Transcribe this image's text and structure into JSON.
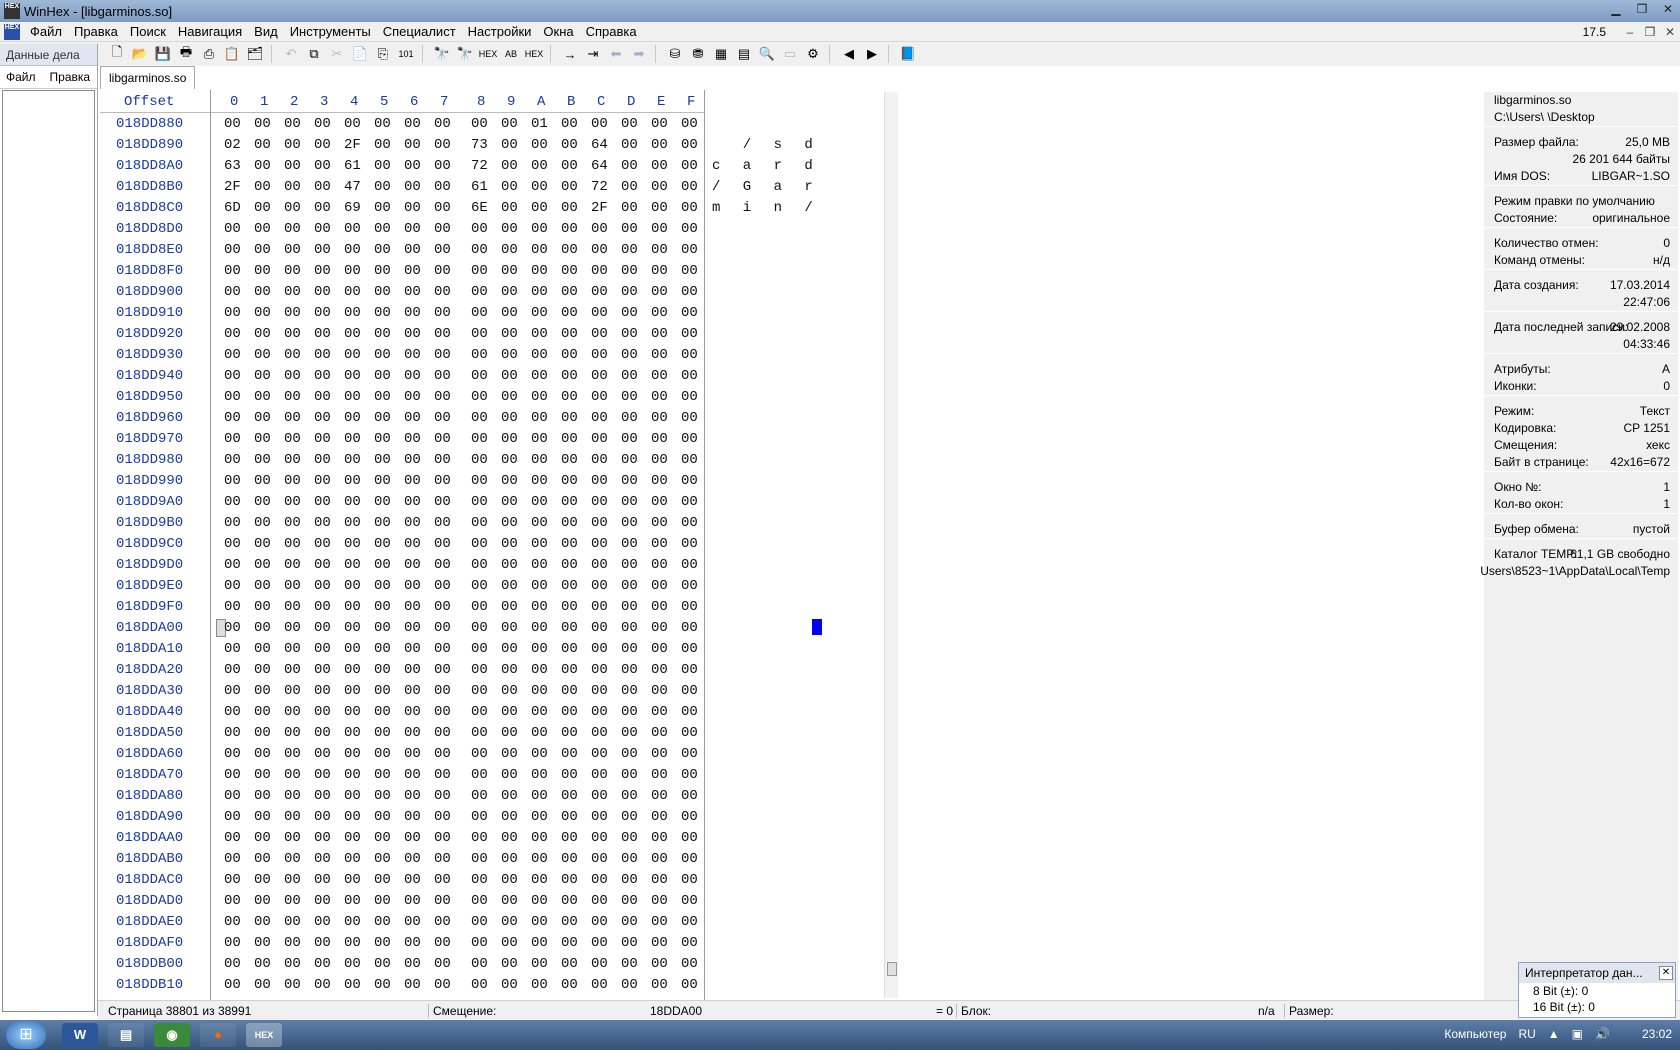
{
  "window": {
    "title": "WinHex - [libgarminos.so]",
    "app_icon": "HEX"
  },
  "menu": [
    "Файл",
    "Правка",
    "Поиск",
    "Навигация",
    "Вид",
    "Инструменты",
    "Специалист",
    "Настройки",
    "Окна",
    "Справка"
  ],
  "zoom": "17.5",
  "left_panel": {
    "title": "Данные дела",
    "menu_file": "Файл",
    "menu_edit": "Правка"
  },
  "tab": "libgarminos.so",
  "hex": {
    "header_offset": "Offset",
    "header_cols": [
      "0",
      "1",
      "2",
      "3",
      "4",
      "5",
      "6",
      "7",
      "8",
      "9",
      "A",
      "B",
      "C",
      "D",
      "E",
      "F"
    ],
    "rows": [
      {
        "off": "018DD880",
        "bytes": [
          "00",
          "00",
          "00",
          "00",
          "00",
          "00",
          "00",
          "00",
          "00",
          "00",
          "01",
          "00",
          "00",
          "00",
          "00",
          "00"
        ],
        "text": [
          "",
          "",
          "",
          "",
          "",
          "",
          "",
          "",
          "",
          "",
          "",
          "",
          "",
          "",
          "",
          ""
        ]
      },
      {
        "off": "018DD890",
        "bytes": [
          "02",
          "00",
          "00",
          "00",
          "2F",
          "00",
          "00",
          "00",
          "73",
          "00",
          "00",
          "00",
          "64",
          "00",
          "00",
          "00"
        ],
        "text": [
          "",
          "",
          "",
          "",
          "/",
          "",
          "",
          "",
          "s",
          "",
          "",
          "",
          "d",
          "",
          "",
          ""
        ]
      },
      {
        "off": "018DD8A0",
        "bytes": [
          "63",
          "00",
          "00",
          "00",
          "61",
          "00",
          "00",
          "00",
          "72",
          "00",
          "00",
          "00",
          "64",
          "00",
          "00",
          "00"
        ],
        "text": [
          "c",
          "",
          "",
          "",
          "a",
          "",
          "",
          "",
          "r",
          "",
          "",
          "",
          "d",
          "",
          "",
          ""
        ]
      },
      {
        "off": "018DD8B0",
        "bytes": [
          "2F",
          "00",
          "00",
          "00",
          "47",
          "00",
          "00",
          "00",
          "61",
          "00",
          "00",
          "00",
          "72",
          "00",
          "00",
          "00"
        ],
        "text": [
          "/",
          "",
          "",
          "",
          "G",
          "",
          "",
          "",
          "a",
          "",
          "",
          "",
          "r",
          "",
          "",
          ""
        ]
      },
      {
        "off": "018DD8C0",
        "bytes": [
          "6D",
          "00",
          "00",
          "00",
          "69",
          "00",
          "00",
          "00",
          "6E",
          "00",
          "00",
          "00",
          "2F",
          "00",
          "00",
          "00"
        ],
        "text": [
          "m",
          "",
          "",
          "",
          "i",
          "",
          "",
          "",
          "n",
          "",
          "",
          "",
          "/",
          "",
          "",
          ""
        ]
      },
      {
        "off": "018DD8D0"
      },
      {
        "off": "018DD8E0"
      },
      {
        "off": "018DD8F0"
      },
      {
        "off": "018DD900"
      },
      {
        "off": "018DD910"
      },
      {
        "off": "018DD920"
      },
      {
        "off": "018DD930"
      },
      {
        "off": "018DD940"
      },
      {
        "off": "018DD950"
      },
      {
        "off": "018DD960"
      },
      {
        "off": "018DD970"
      },
      {
        "off": "018DD980"
      },
      {
        "off": "018DD990"
      },
      {
        "off": "018DD9A0"
      },
      {
        "off": "018DD9B0"
      },
      {
        "off": "018DD9C0"
      },
      {
        "off": "018DD9D0"
      },
      {
        "off": "018DD9E0"
      },
      {
        "off": "018DD9F0"
      },
      {
        "off": "018DDA00"
      },
      {
        "off": "018DDA10"
      },
      {
        "off": "018DDA20"
      },
      {
        "off": "018DDA30"
      },
      {
        "off": "018DDA40"
      },
      {
        "off": "018DDA50"
      },
      {
        "off": "018DDA60"
      },
      {
        "off": "018DDA70"
      },
      {
        "off": "018DDA80"
      },
      {
        "off": "018DDA90"
      },
      {
        "off": "018DDAA0"
      },
      {
        "off": "018DDAB0"
      },
      {
        "off": "018DDAC0"
      },
      {
        "off": "018DDAD0"
      },
      {
        "off": "018DDAE0"
      },
      {
        "off": "018DDAF0"
      },
      {
        "off": "018DDB00"
      },
      {
        "off": "018DDB10"
      }
    ],
    "default_byte": "00"
  },
  "info": {
    "file_name": "libgarminos.so",
    "path": "C:\\Users\\          \\Desktop",
    "rows": [
      {
        "k": "Размер файла:",
        "v": "25,0 MB"
      },
      {
        "k": "",
        "v": "26 201 644 байты"
      },
      {
        "k": "Имя DOS:",
        "v": "LIBGAR~1.SO"
      },
      {
        "gap": true
      },
      {
        "k": "Режим правки по умолчанию",
        "v": ""
      },
      {
        "k": "Состояние:",
        "v": "оригинальное"
      },
      {
        "gap": true
      },
      {
        "k": "Количество отмен:",
        "v": "0"
      },
      {
        "k": "Команд отмены:",
        "v": "н/д"
      },
      {
        "gap": true
      },
      {
        "k": "Дата создания:",
        "v": "17.03.2014"
      },
      {
        "k": "",
        "v": "22:47:06"
      },
      {
        "gap": true
      },
      {
        "k": "Дата последней записи:",
        "v": "29.02.2008"
      },
      {
        "k": "",
        "v": "04:33:46"
      },
      {
        "gap": true
      },
      {
        "k": "Атрибуты:",
        "v": "A"
      },
      {
        "k": "Иконки:",
        "v": "0"
      },
      {
        "gap": true
      },
      {
        "k": "Режим:",
        "v": "Текст"
      },
      {
        "k": "Кодировка:",
        "v": "CP 1251"
      },
      {
        "k": "Смещения:",
        "v": "хекс"
      },
      {
        "k": "Байт в странице:",
        "v": "42x16=672"
      },
      {
        "gap": true
      },
      {
        "k": "Окно №:",
        "v": "1"
      },
      {
        "k": "Кол-во окон:",
        "v": "1"
      },
      {
        "gap": true
      },
      {
        "k": "Буфер обмена:",
        "v": "пустой"
      },
      {
        "gap": true
      },
      {
        "k": "Каталог TEMP:",
        "v": "61,1 GB свободно"
      },
      {
        "k": "",
        "v": "Users\\8523~1\\AppData\\Local\\Temp"
      }
    ]
  },
  "status": {
    "page": "Страница 38801 из 38991",
    "offset_label": "Смещение:",
    "offset_value": "18DDA00",
    "eq": "= 0",
    "block_label": "Блок:",
    "na": "n/a",
    "size_label": "Размер:"
  },
  "interpreter": {
    "title": "Интерпретатор дан...",
    "row8": "8 Bit (±):  0",
    "row16": "16 Bit (±):  0"
  },
  "taskbar": {
    "apps": [
      "W",
      "▤",
      "◉",
      "●",
      "HEX"
    ],
    "tray_computer": "Компьютер",
    "tray_lang": "RU",
    "clock": "23:02"
  }
}
